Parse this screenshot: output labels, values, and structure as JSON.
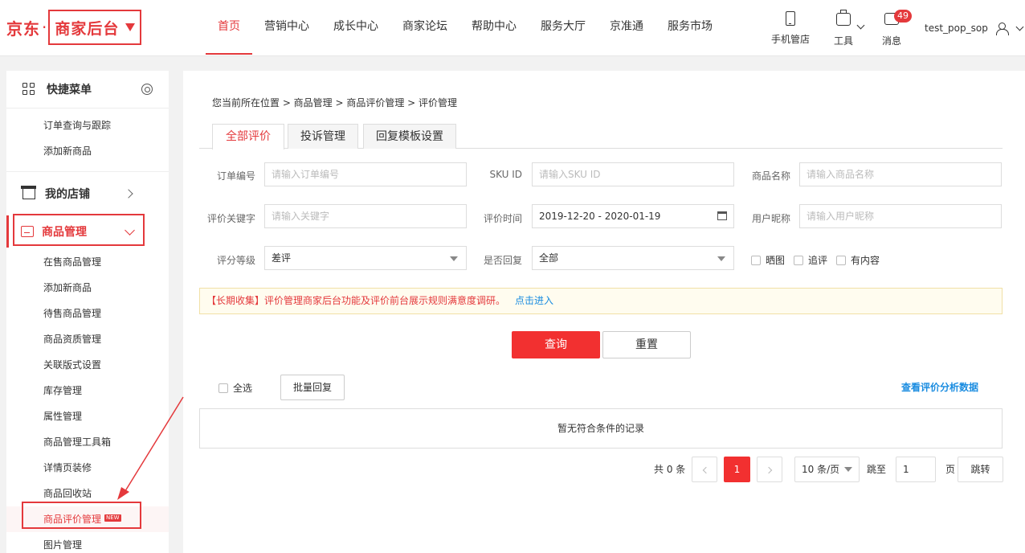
{
  "header": {
    "logo_brand": "京东",
    "logo_dot": "·",
    "logo_title": "商家后台",
    "nav": [
      {
        "label": "首页",
        "active": true
      },
      {
        "label": "营销中心"
      },
      {
        "label": "成长中心"
      },
      {
        "label": "商家论坛"
      },
      {
        "label": "帮助中心"
      },
      {
        "label": "服务大厅"
      },
      {
        "label": "京准通"
      },
      {
        "label": "服务市场"
      }
    ],
    "tools": {
      "phone_label": "手机管店",
      "tool_label": "工具",
      "msg_label": "消息",
      "msg_count": "49"
    },
    "username": "test_pop_sop"
  },
  "sidebar": {
    "quick_title": "快捷菜单",
    "quick_items": [
      "订单查询与跟踪",
      "添加新商品"
    ],
    "store_title": "我的店铺",
    "goods_title": "商品管理",
    "goods_items": [
      "在售商品管理",
      "添加新商品",
      "待售商品管理",
      "商品资质管理",
      "关联版式设置",
      "库存管理",
      "属性管理",
      "商品管理工具箱",
      "详情页装修",
      "商品回收站",
      "商品评价管理",
      "图片管理"
    ],
    "new_badge": "NEW"
  },
  "main": {
    "breadcrumb": "您当前所在位置 > 商品管理 > 商品评价管理 > 评价管理",
    "tabs": [
      "全部评价",
      "投诉管理",
      "回复模板设置"
    ],
    "form": {
      "order_label": "订单编号",
      "order_placeholder": "请输入订单编号",
      "sku_label": "SKU ID",
      "sku_placeholder": "请输入SKU ID",
      "name_label": "商品名称",
      "name_placeholder": "请输入商品名称",
      "kw_label": "评价关键字",
      "kw_placeholder": "请输入关键字",
      "time_label": "评价时间",
      "time_value": "2019-12-20 - 2020-01-19",
      "nick_label": "用户昵称",
      "nick_placeholder": "请输入用户昵称",
      "level_label": "评分等级",
      "level_value": "差评",
      "reply_label": "是否回复",
      "reply_value": "全部",
      "chk_image": "晒图",
      "chk_follow": "追评",
      "chk_content": "有内容"
    },
    "notice_text": "【长期收集】评价管理商家后台功能及评价前台展示规则满意度调研。",
    "notice_link": "点击进入",
    "btn_query": "查询",
    "btn_reset": "重置",
    "select_all": "全选",
    "btn_batch": "批量回复",
    "analysis_link": "查看评价分析数据",
    "empty_text": "暂无符合条件的记录",
    "pager": {
      "total": "共 0 条",
      "current_page": "1",
      "page_size": "10 条/页",
      "jump_label": "跳至",
      "jump_value": "1",
      "page_unit": "页",
      "jump_button": "跳转"
    }
  },
  "colors": {
    "accent": "#e4393c",
    "link": "#1a8ce0"
  }
}
